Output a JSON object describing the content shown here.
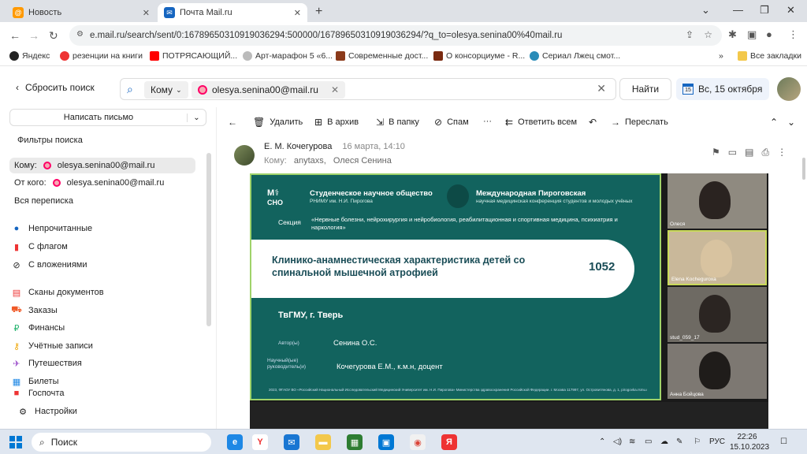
{
  "browser": {
    "tabs": [
      {
        "label": "Новость",
        "active": false
      },
      {
        "label": "Почта Mail.ru",
        "active": true
      }
    ],
    "url": "e.mail.ru/search/sent/0:16789650310919036294:500000/16789650310919036294/?q_to=olesya.senina00%40mail.ru",
    "bookmarks": [
      "Яндекс",
      "резенции на книги",
      "ПОТРЯСАЮЩИЙ...",
      "Арт-марафон 5 «6...",
      "Современные дост...",
      "О консорциуме - R...",
      "Сериал Лжец смот..."
    ],
    "bookmarks_more": "»",
    "all_bookmarks": "Все закладки"
  },
  "header": {
    "back_label": "Сбросить поиск",
    "search_field_chip": "Кому",
    "search_value_chip": "olesya.senina00@mail.ru",
    "find_button": "Найти",
    "calendar_day": "15",
    "date_label": "Вс, 15 октября"
  },
  "sidebar": {
    "compose_label": "Написать письмо",
    "filters_label": "Фильтры поиска",
    "to_label": "Кому:",
    "to_value": "olesya.senina00@mail.ru",
    "from_label": "От кого:",
    "from_value": "olesya.senina00@mail.ru",
    "all_mail": "Вся переписка",
    "filters": [
      "Непрочитанные",
      "С флагом",
      "С вложениями"
    ],
    "folders": [
      "Сканы документов",
      "Заказы",
      "Финансы",
      "Учётные записи",
      "Путешествия",
      "Билеты",
      "Госпочта"
    ],
    "settings": "Настройки"
  },
  "toolbar": {
    "delete": "Удалить",
    "archive": "В архив",
    "to_folder": "В папку",
    "spam": "Спам",
    "more": "···",
    "reply_all": "Ответить всем",
    "forward": "Переслать"
  },
  "message": {
    "sender": "Е. М. Кочегурова",
    "date": "16 марта, 14:10",
    "to_label": "Кому:",
    "to_1": "anytaxs,",
    "to_2": "Олеся Сенина"
  },
  "slide": {
    "logo_text": "СНО",
    "org1": "Студенческое научное общество",
    "org1_sub": "РНИМУ им. Н.И. Пирогова",
    "org2": "Международная Пироговская",
    "org2_sub": "научная медицинская конференция студентов и молодых учёных",
    "section_label": "Секция",
    "section_text": "«Нервные болезни, нейрохирургия и нейробиология, реабилитационная и спортивная медицина, психиатрия и наркология»",
    "title": "Клинико-анамнестическая характеристика детей со спинальной мышечной атрофией",
    "number": "1052",
    "university": "ТвГМУ, г. Тверь",
    "author_label": "Автор(ы)",
    "author_value": "Сенина О.С.",
    "supervisor_label": "Научный(ые) руководитель(и)",
    "supervisor_value": "Кочегурова Е.М., к.м.н, доцент",
    "footer": "2023, ФГАОУ ВО «Российский Национальный Исследовательский Медицинский Университет им. Н.И. Пирогова» Министерства здравоохранения Российской Федерации. г. Москва 117997, ул. Островитянова, д. 1, pirogovka.rsmu.ru"
  },
  "participants": [
    "Олеся",
    "Elena Kocheguroxa",
    "stud_059_17",
    "Анна Бойцова"
  ],
  "taskbar": {
    "search": "Поиск",
    "lang": "РУС",
    "time": "22:26",
    "date": "15.10.2023"
  }
}
